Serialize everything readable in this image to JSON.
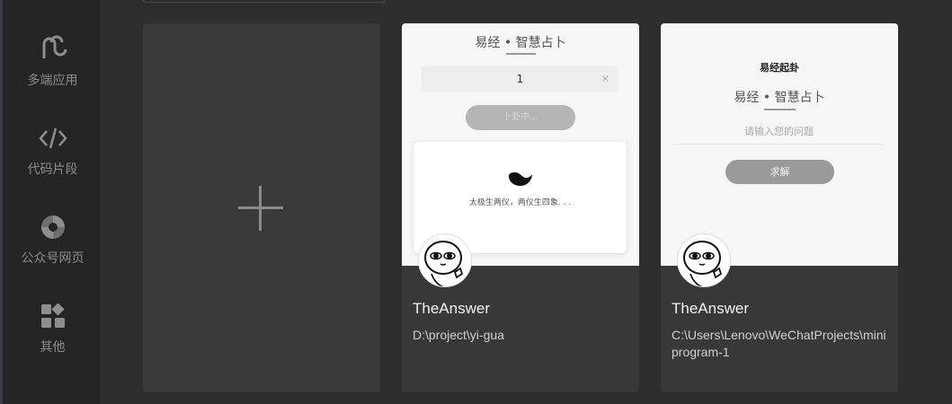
{
  "sidebar": {
    "items": [
      {
        "label": "多端应用",
        "icon": "link-icon"
      },
      {
        "label": "代码片段",
        "icon": "code-icon"
      },
      {
        "label": "公众号网页",
        "icon": "swirl-icon"
      },
      {
        "label": "其他",
        "icon": "grid-icon"
      }
    ]
  },
  "new_project": {
    "icon": "plus-icon"
  },
  "projects": [
    {
      "name": "TheAnswer",
      "path": "D:\\project\\yi-gua",
      "preview": {
        "title": "易经 • 智慧占卜",
        "input_value": "1",
        "clear_symbol": "×",
        "button_label": "卜卦中...",
        "result_text": "太极生两仪，两仪生四象. . ."
      }
    },
    {
      "name": "TheAnswer",
      "path": "C:\\Users\\Lenovo\\WeChatProjects\\miniprogram-1",
      "preview": {
        "heading": "易经起卦",
        "title": "易经 • 智慧占卜",
        "placeholder": "请输入您的问题",
        "button_label": "求解"
      }
    }
  ]
}
